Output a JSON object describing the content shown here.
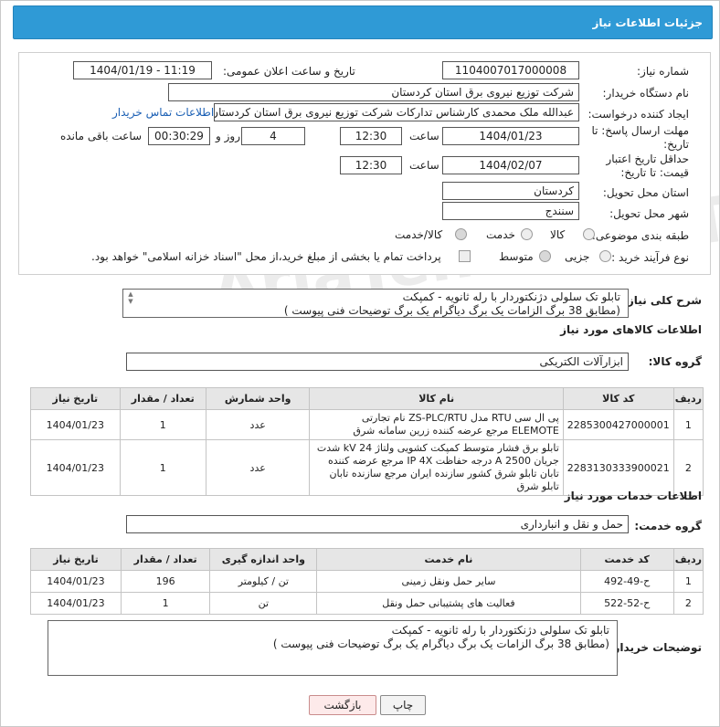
{
  "header": {
    "title": "جزئیات اطلاعات نیاز"
  },
  "form": {
    "need_number": {
      "label": "شماره نیاز:",
      "value": "1104007017000008"
    },
    "announce": {
      "label": "تاریخ و ساعت اعلان عمومی:",
      "value": "1404/01/19 - 11:19"
    },
    "buyer_org": {
      "label": "نام دستگاه خریدار:",
      "value": "شرکت توزیع نیروی برق استان کردستان"
    },
    "requester": {
      "label": "ایجاد کننده درخواست:",
      "value": "عبدالله ملک محمدی کارشناس تدارکات شرکت توزیع نیروی برق استان کردستان",
      "contact_link": "اطلاعات تماس خریدار"
    },
    "deadline": {
      "label": "مهلت ارسال پاسخ: تا تاریخ:",
      "date": "1404/01/23",
      "time_label": "ساعت",
      "time": "12:30",
      "days": "4",
      "days_label": "روز و",
      "remaining": "00:30:29",
      "remaining_label": "ساعت باقی مانده"
    },
    "validity": {
      "label": "حداقل تاریخ اعتبار قیمت: تا تاریخ:",
      "date": "1404/02/07",
      "time_label": "ساعت",
      "time": "12:30"
    },
    "province": {
      "label": "استان محل تحویل:",
      "value": "کردستان"
    },
    "city": {
      "label": "شهر محل تحویل:",
      "value": "سنندج"
    },
    "category": {
      "label": "طبقه بندی موضوعی:",
      "options": [
        "کالا",
        "خدمت",
        "کالا/خدمت"
      ],
      "selected": "کالا/خدمت"
    },
    "process": {
      "label": "نوع فرآیند خرید :",
      "options": [
        "جزیی",
        "متوسط"
      ],
      "selected": "متوسط",
      "note": "پرداخت تمام یا بخشی از مبلغ خرید،از محل \"اسناد خزانه اسلامی\" خواهد بود."
    }
  },
  "general_desc": {
    "label": "شرح کلی نیاز:",
    "text": "تابلو تک سلولی دژنکتوردار با رله ثانویه - کمپکت\n(مطابق 38 برگ الزامات یک برگ دیاگرام یک برگ توضیحات فنی پیوست )"
  },
  "goods": {
    "section_title": "اطلاعات کالاهای مورد نیاز",
    "group_label": "گروه کالا:",
    "group_value": "ابزارآلات الکتریکی",
    "headers": [
      "ردیف",
      "کد کالا",
      "نام کالا",
      "واحد شمارش",
      "تعداد / مقدار",
      "تاریخ نیاز"
    ],
    "rows": [
      {
        "idx": "1",
        "code": "2285300427000001",
        "name": "پی ال سی RTU مدل ZS-PLC/RTU نام تجارتی ELEMOTE مرجع عرضه کننده زرین سامانه شرق",
        "unit": "عدد",
        "qty": "1",
        "date": "1404/01/23"
      },
      {
        "idx": "2",
        "code": "2283130333900021",
        "name": "تابلو برق فشار متوسط کمپکت کشویی ولتاژ kV 24 شدت جریان A 2500 درجه حفاظت IP 4X مرجع عرضه کننده تابان تابلو شرق کشور سازنده ایران مرجع سازنده تابان تابلو شرق",
        "unit": "عدد",
        "qty": "1",
        "date": "1404/01/23"
      }
    ]
  },
  "services": {
    "section_title": "اطلاعات خدمات مورد نیاز",
    "group_label": "گروه خدمت:",
    "group_value": "حمل و نقل و انبارداری",
    "headers": [
      "ردیف",
      "کد خدمت",
      "نام خدمت",
      "واحد اندازه گیری",
      "تعداد / مقدار",
      "تاریخ نیاز"
    ],
    "rows": [
      {
        "idx": "1",
        "code": "ح-49-492",
        "name": "سایر حمل ونقل زمینی",
        "unit": "تن / کیلومتر",
        "qty": "196",
        "date": "1404/01/23"
      },
      {
        "idx": "2",
        "code": "ح-52-522",
        "name": "فعالیت های پشتیبانی حمل ونقل",
        "unit": "تن",
        "qty": "1",
        "date": "1404/01/23"
      }
    ]
  },
  "buyer_desc": {
    "label": "توضیحات خریدار:",
    "text": "تابلو تک سلولی دژنکتوردار با رله ثانویه - کمپکت\n(مطابق 38 برگ الزامات یک برگ دیاگرام یک برگ توضیحات فنی پیوست )"
  },
  "buttons": {
    "print": "چاپ",
    "back": "بازگشت"
  },
  "watermark": "AriaTender.neT"
}
